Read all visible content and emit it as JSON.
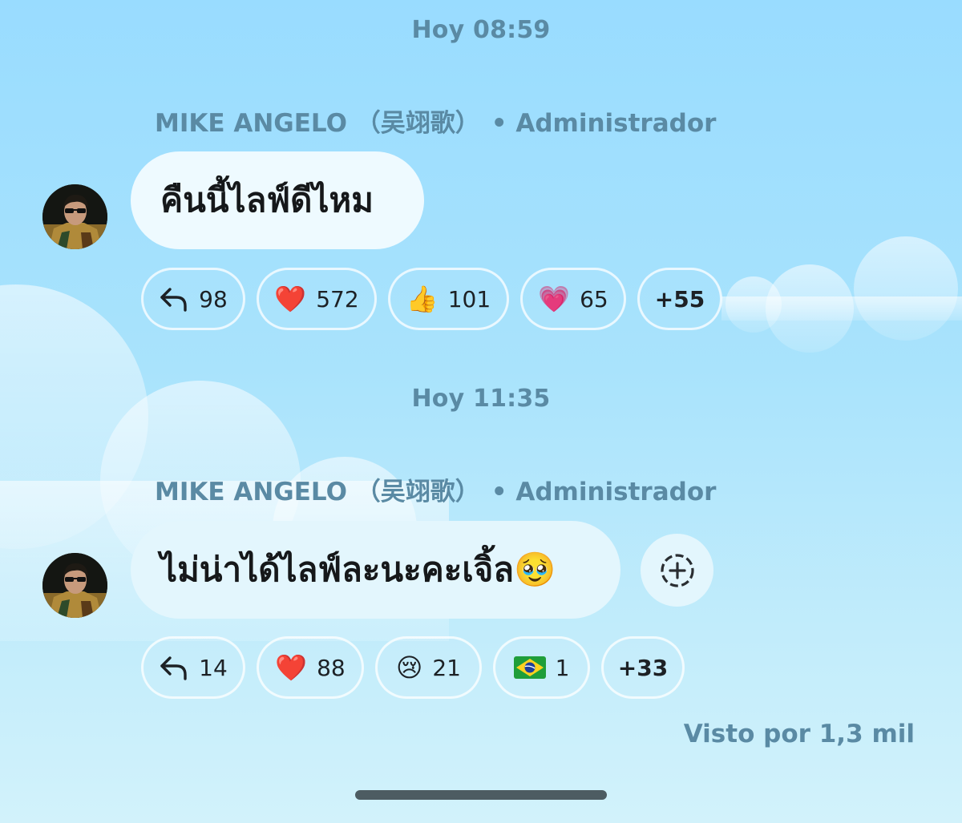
{
  "messages": [
    {
      "timestamp": "Hoy 08:59",
      "sender": "MIKE ANGELO （吴翊歌）",
      "role": "• Administrador",
      "text": "คืนนี้ไลฟ์ดีไหม",
      "reactions": [
        {
          "icon": "reply-arrow-icon",
          "emoji": "",
          "count": "98"
        },
        {
          "icon": "red-heart-icon",
          "emoji": "❤️",
          "count": "572"
        },
        {
          "icon": "thumbs-up-icon",
          "emoji": "👍",
          "count": "101"
        },
        {
          "icon": "growing-heart-icon",
          "emoji": "💗",
          "count": "65"
        }
      ],
      "more": "+55"
    },
    {
      "timestamp": "Hoy 11:35",
      "sender": "MIKE ANGELO （吴翊歌）",
      "role": "• Administrador",
      "text": "ไม่น่าได้ไลฟ์ละนะคะเจิ้ล🥹",
      "reactions": [
        {
          "icon": "reply-arrow-icon",
          "emoji": "",
          "count": "14"
        },
        {
          "icon": "red-heart-icon",
          "emoji": "❤️",
          "count": "88"
        },
        {
          "icon": "crying-face-icon",
          "emoji": "😢",
          "count": "21"
        },
        {
          "icon": "brazil-flag-icon",
          "emoji": "🇧🇷",
          "count": "1"
        }
      ],
      "more": "+33"
    }
  ],
  "seen": "Visto por 1,3 mil",
  "colors": {
    "accent_text": "#5a8aa4",
    "bubble": "#eefaff",
    "background_top": "#99dcff",
    "background_bottom": "#d2f2fb"
  }
}
